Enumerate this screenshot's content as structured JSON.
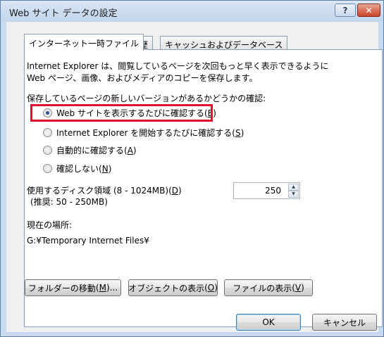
{
  "window": {
    "title": "Web サイト データの設定",
    "help_glyph": "?",
    "close_glyph": "✕"
  },
  "tabs": [
    {
      "label": "インターネット一時ファイル",
      "active": true
    },
    {
      "label": "履歴",
      "active": false
    },
    {
      "label": "キャッシュおよびデータベース",
      "active": false
    }
  ],
  "description": {
    "line1": "Internet Explorer は、閲覧しているページを次回もっと早く表示できるように",
    "line2": "Web ページ、画像、およびメディアのコピーを保存します。"
  },
  "check_section": {
    "heading": "保存しているページの新しいバージョンがあるかどうかの確認:",
    "options": [
      {
        "label": "Web サイトを表示するたびに確認する",
        "access_key": "E",
        "checked": true
      },
      {
        "label": "Internet Explorer を開始するたびに確認する",
        "access_key": "S",
        "checked": false
      },
      {
        "label": "自動的に確認する",
        "access_key": "A",
        "checked": false
      },
      {
        "label": "確認しない",
        "access_key": "N",
        "checked": false
      }
    ]
  },
  "disk": {
    "label": "使用するディスク領域 (8 - 1024MB)",
    "access_key": "D",
    "recommend": "(推奨: 50 - 250MB)",
    "value": "250"
  },
  "location": {
    "label": "現在の場所:",
    "path": "G:¥Temporary Internet Files¥"
  },
  "buttons": {
    "move_folder": {
      "label": "フォルダーの移動",
      "access_key": "M",
      "suffix": "..."
    },
    "view_objects": {
      "label": "オブジェクトの表示",
      "access_key": "O"
    },
    "view_files": {
      "label": "ファイルの表示",
      "access_key": "V"
    },
    "ok": "OK",
    "cancel": "キャンセル"
  },
  "colors": {
    "highlight": "#e0102d",
    "window_frame": "#c7daef",
    "close_button": "#c9432b"
  }
}
